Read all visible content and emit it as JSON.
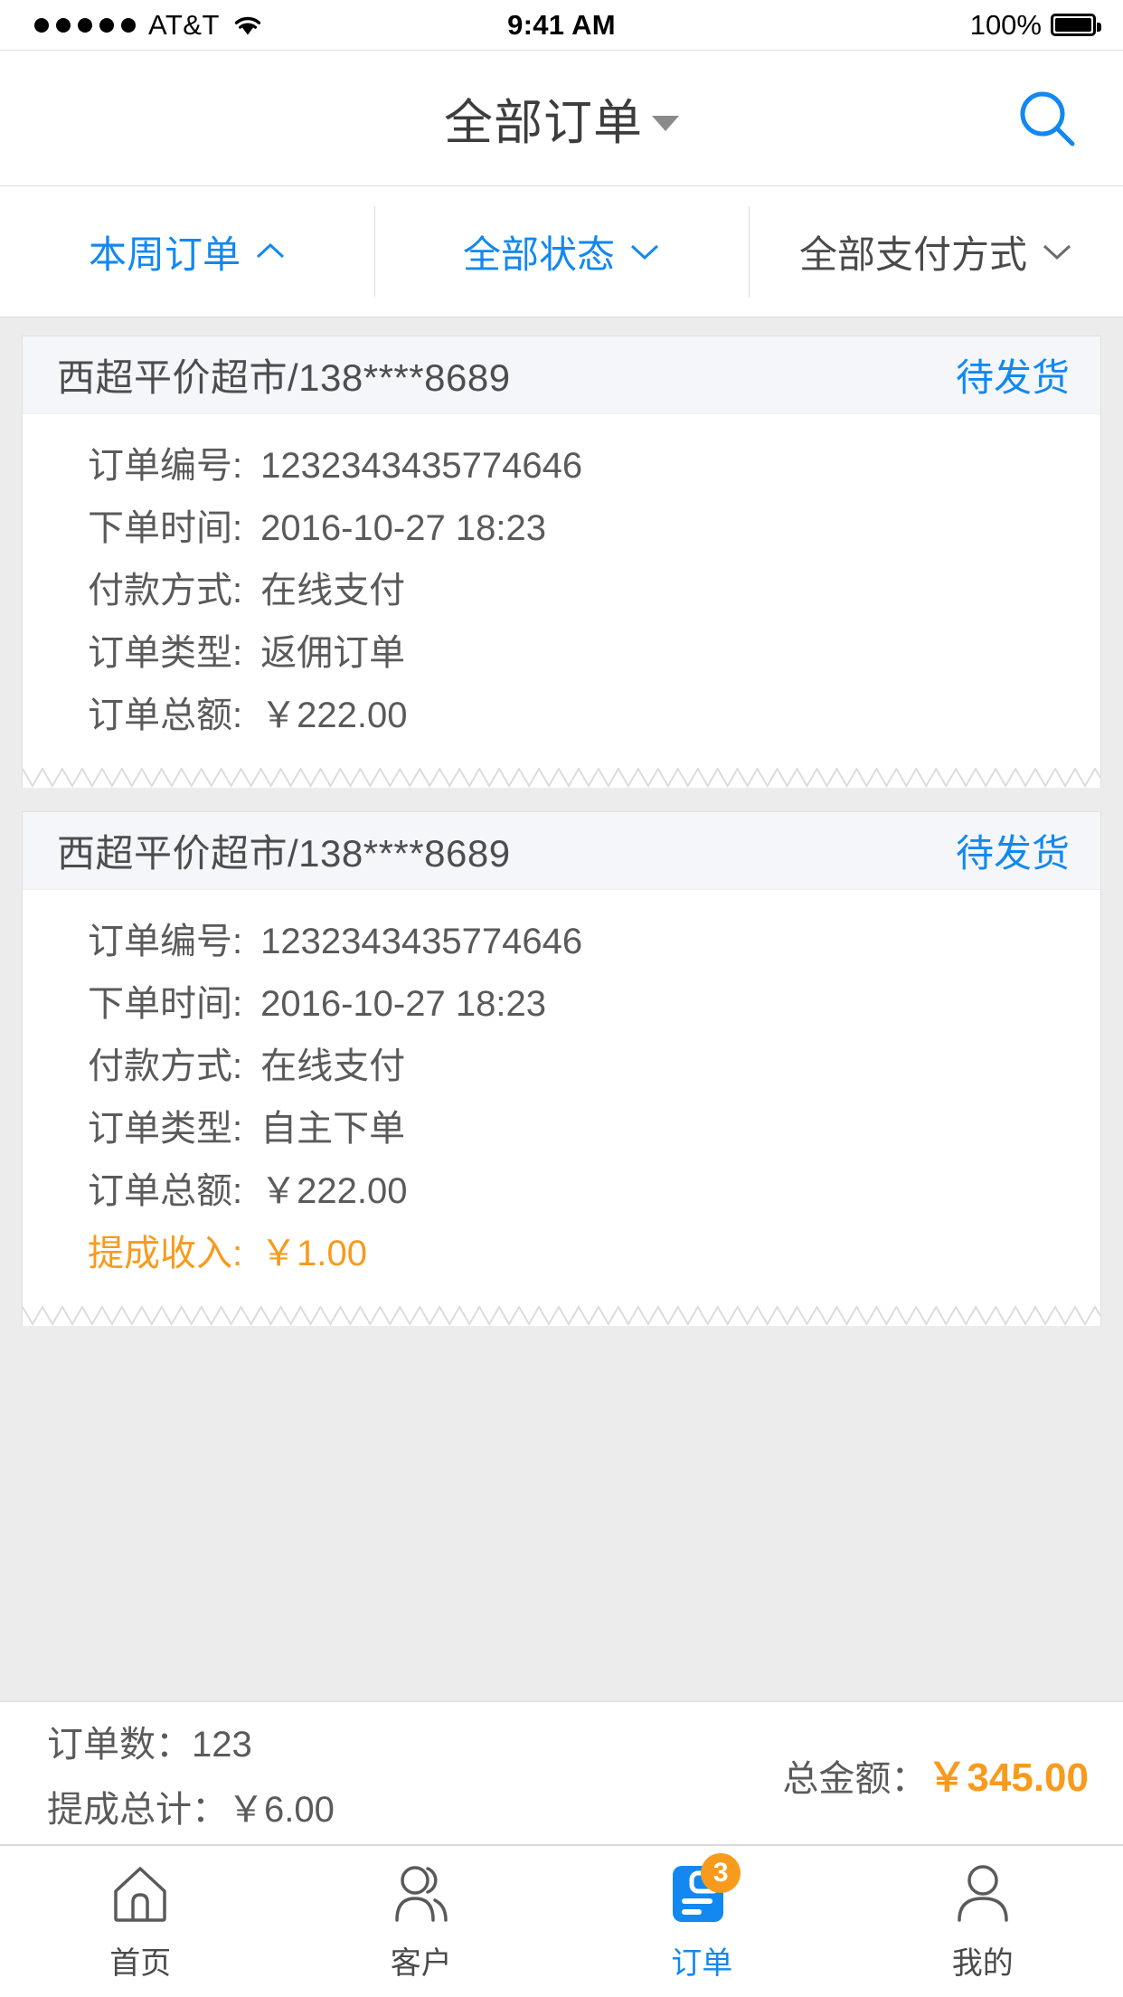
{
  "status_bar": {
    "carrier": "AT&T",
    "signal_dots": 5,
    "wifi_icon": "wifi-icon",
    "time": "9:41 AM",
    "battery_percent": "100%",
    "battery_icon": "battery-full-icon"
  },
  "navbar": {
    "title": "全部订单",
    "dropdown_icon": "caret-down-icon",
    "search_icon": "search-icon"
  },
  "filters": [
    {
      "label": "本周订单",
      "chevron": "chevron-up-icon",
      "active": true
    },
    {
      "label": "全部状态",
      "chevron": "chevron-down-icon",
      "active": true
    },
    {
      "label": "全部支付方式",
      "chevron": "chevron-down-icon",
      "active": false
    }
  ],
  "orders": [
    {
      "shop": "西超平价超市/138****8689",
      "status": "待发货",
      "rows": [
        {
          "label": "订单编号:",
          "value": "1232343435774646"
        },
        {
          "label": "下单时间:",
          "value": "2016-10-27 18:23"
        },
        {
          "label": "付款方式:",
          "value": "在线支付"
        },
        {
          "label": "订单类型:",
          "value": "返佣订单"
        },
        {
          "label": "订单总额:",
          "value": "￥222.00"
        }
      ]
    },
    {
      "shop": "西超平价超市/138****8689",
      "status": "待发货",
      "rows": [
        {
          "label": "订单编号:",
          "value": "1232343435774646"
        },
        {
          "label": "下单时间:",
          "value": "2016-10-27 18:23"
        },
        {
          "label": "付款方式:",
          "value": "在线支付"
        },
        {
          "label": "订单类型:",
          "value": "自主下单"
        },
        {
          "label": "订单总额:",
          "value": "￥222.00"
        },
        {
          "label": "提成收入:",
          "value": "￥1.00",
          "highlight": true
        }
      ]
    }
  ],
  "summary": {
    "order_count_label": "订单数：123",
    "commission_total_label": "提成总计：￥6.00",
    "total_label": "总金额：",
    "total_amount": "￥345.00"
  },
  "tabbar": [
    {
      "label": "首页",
      "icon": "home-icon",
      "active": false,
      "badge": ""
    },
    {
      "label": "客户",
      "icon": "customers-icon",
      "active": false,
      "badge": ""
    },
    {
      "label": "订单",
      "icon": "orders-icon",
      "active": true,
      "badge": "3"
    },
    {
      "label": "我的",
      "icon": "profile-icon",
      "active": false,
      "badge": ""
    }
  ],
  "colors": {
    "accent_blue": "#1288f0",
    "accent_orange": "#f89a1c",
    "page_bg": "#ececec",
    "card_header_bg": "#f4f6f9",
    "text_primary": "#4a4a4a"
  }
}
